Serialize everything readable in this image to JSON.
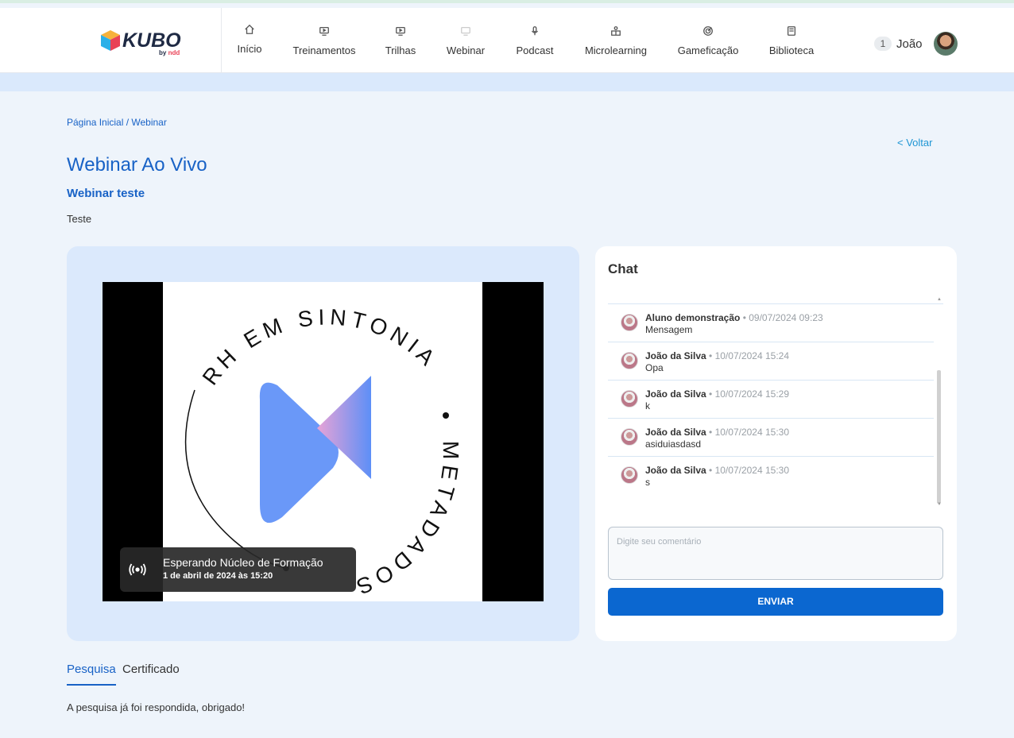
{
  "brand": {
    "name": "KUBO",
    "by": "by",
    "by_brand": "ndd"
  },
  "nav": [
    {
      "label": "Início",
      "icon": "home-icon"
    },
    {
      "label": "Treinamentos",
      "icon": "screen-play-icon"
    },
    {
      "label": "Trilhas",
      "icon": "screen-play-icon"
    },
    {
      "label": "Webinar",
      "icon": "webinar-icon"
    },
    {
      "label": "Podcast",
      "icon": "microphone-icon"
    },
    {
      "label": "Microlearning",
      "icon": "book-person-icon"
    },
    {
      "label": "Gameficação",
      "icon": "target-icon"
    },
    {
      "label": "Biblioteca",
      "icon": "book-icon"
    }
  ],
  "user": {
    "badge": "1",
    "name": "João"
  },
  "breadcrumb": "Página Inicial / Webinar",
  "back": "< Voltar",
  "page_title": "Webinar Ao Vivo",
  "webinar": {
    "name": "Webinar teste",
    "description": "Teste"
  },
  "video": {
    "ring_text_top": "RH EM SINTONIA",
    "ring_text_right": "METADADOS",
    "status_title": "Esperando Núcleo de Formação",
    "status_date": "1 de abril de 2024 às 15:20"
  },
  "chat": {
    "title": "Chat",
    "messages": [
      {
        "author": "Aluno demonstração",
        "time": "• 09/07/2024 09:23",
        "text": "Mensagem"
      },
      {
        "author": "João da Silva",
        "time": "• 10/07/2024 15:24",
        "text": "Opa"
      },
      {
        "author": "João da Silva",
        "time": "• 10/07/2024 15:29",
        "text": "k"
      },
      {
        "author": "João da Silva",
        "time": "• 10/07/2024 15:30",
        "text": "asiduiasdasd"
      },
      {
        "author": "João da Silva",
        "time": "• 10/07/2024 15:30",
        "text": "s"
      }
    ],
    "input_placeholder": "Digite seu comentário",
    "send_label": "ENVIAR"
  },
  "tabs": [
    {
      "label": "Pesquisa",
      "active": true
    },
    {
      "label": "Certificado",
      "active": false
    }
  ],
  "tab_content": "A pesquisa já foi respondida, obrigado!",
  "colors": {
    "primary": "#1862c6",
    "button": "#0b67d0",
    "panel": "#dbe9fc",
    "background": "#eef4fb"
  }
}
